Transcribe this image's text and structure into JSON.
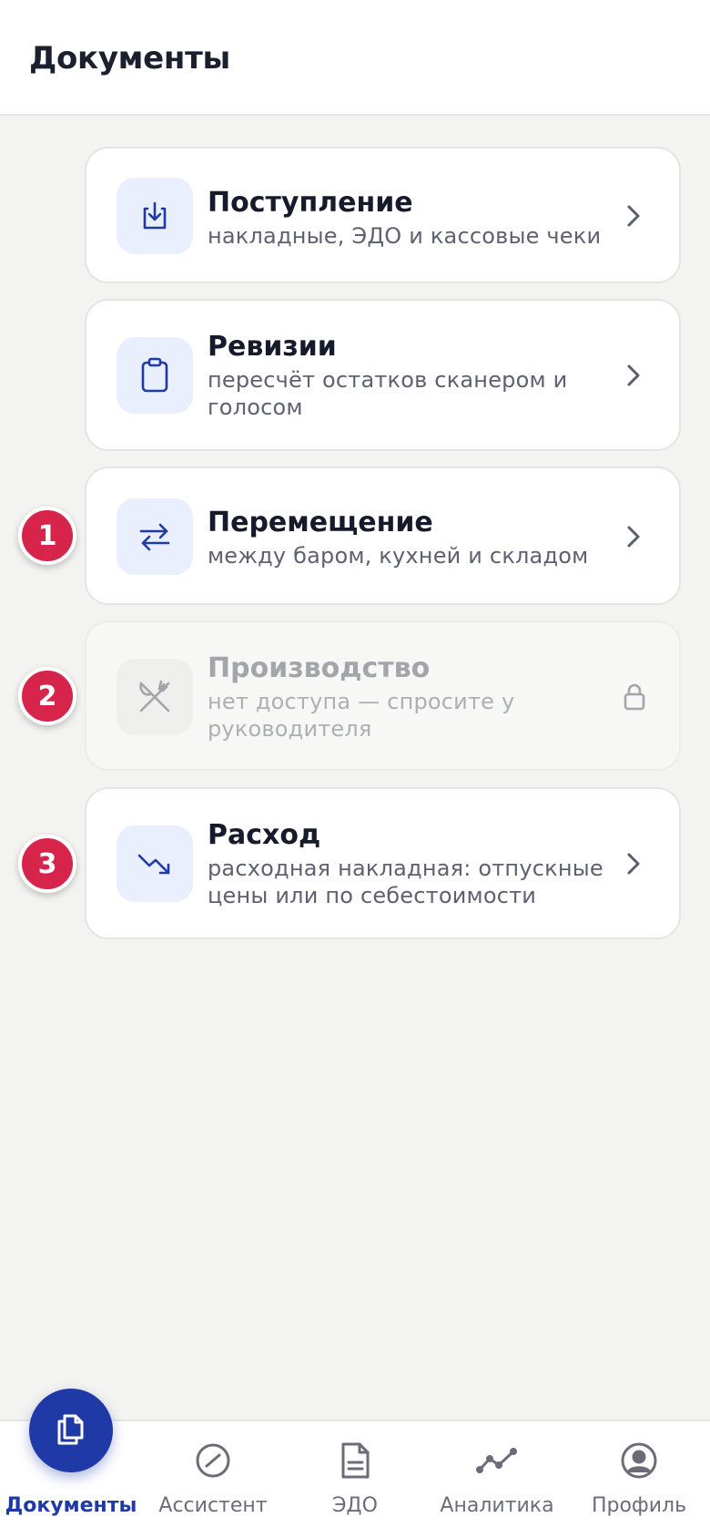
{
  "header": {
    "title": "Документы"
  },
  "cards": [
    {
      "title": "Поступление",
      "subtitle": "накладные, ЭДО и кассовые чеки",
      "icon": "download-tray-icon",
      "state": "enabled"
    },
    {
      "title": "Ревизии",
      "subtitle": "пересчёт остатков сканером и голосом",
      "icon": "clipboard-icon",
      "state": "enabled"
    },
    {
      "title": "Перемещение",
      "subtitle": "между баром, кухней и складом",
      "icon": "transfer-arrows-icon",
      "state": "enabled"
    },
    {
      "title": "Производство",
      "subtitle": "нет доступа — спросите у руководителя",
      "icon": "fork-knife-icon",
      "state": "locked"
    },
    {
      "title": "Расход",
      "subtitle": "расходная накладная: отпускные цены или по себестоимости",
      "icon": "trend-down-icon",
      "state": "enabled"
    }
  ],
  "badges": [
    "1",
    "2",
    "3"
  ],
  "nav": {
    "items": [
      {
        "label": "Документы",
        "icon": "documents-icon",
        "active": true
      },
      {
        "label": "Ассистент",
        "icon": "assistant-icon",
        "active": false
      },
      {
        "label": "ЭДО",
        "icon": "edo-document-icon",
        "active": false
      },
      {
        "label": "Аналитика",
        "icon": "analytics-icon",
        "active": false
      },
      {
        "label": "Профиль",
        "icon": "profile-icon",
        "active": false
      }
    ]
  },
  "colors": {
    "accent": "#1f3aa6",
    "badge": "#d6244a",
    "background": "#f3f3f1",
    "icon_tile": "#e9effd"
  }
}
